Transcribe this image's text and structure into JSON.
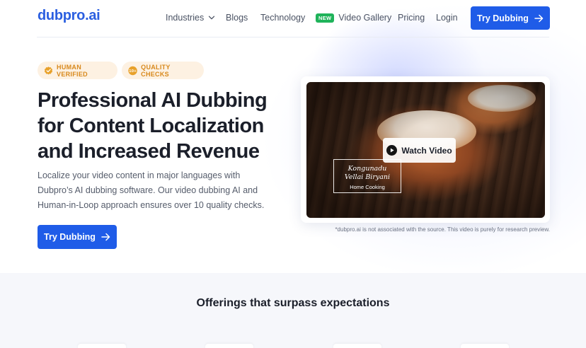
{
  "nav": {
    "logo": "dubpro.ai",
    "industries": "Industries",
    "blogs": "Blogs",
    "technology": "Technology",
    "new_badge": "NEW",
    "video_gallery": "Video Gallery",
    "pricing": "Pricing",
    "login": "Login",
    "cta": "Try Dubbing"
  },
  "badges": {
    "verified": "HUMAN VERIFIED",
    "quality_icon_text": "10+",
    "quality": "QUALITY CHECKS"
  },
  "hero": {
    "title_line1": "Professional AI Dubbing",
    "title_line2": "for Content Localization",
    "title_line3": "and Increased Revenue",
    "desc_line1": "Localize your video content in major languages with",
    "desc_line2": "Dubpro’s AI dubbing software. Our video dubbing AI and",
    "desc_line3": "Human-in-Loop approach ensures over 10 quality checks.",
    "cta": "Try Dubbing"
  },
  "video": {
    "watch_label": "Watch Video",
    "card_line1": "Kongunadu",
    "card_line2": "Vellai Biryani",
    "card_line3": "Home Cooking",
    "disclaimer": "*dubpro.ai is not associated with the source. This video is purely for research preview."
  },
  "offerings": {
    "title": "Offerings that surpass expectations"
  },
  "colors": {
    "brand": "#1f5ce8",
    "badge_bg": "#fdf1e2",
    "badge_text": "#d8891c",
    "new_badge": "#1fb35a"
  },
  "icons": {
    "industries_chevron": "chevron-down-icon",
    "cta_arrow": "arrow-right-icon",
    "verified": "verified-badge-icon",
    "play": "play-icon"
  }
}
